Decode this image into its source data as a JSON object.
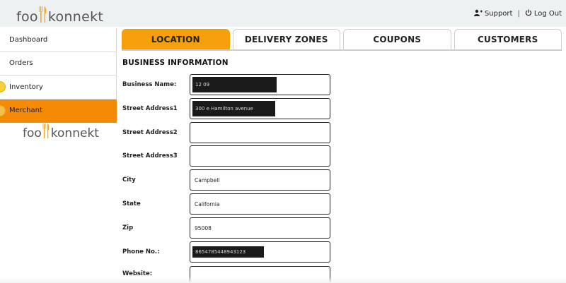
{
  "header": {
    "logo_text_left": "foo",
    "logo_text_right": "konnekt",
    "support_label": "Support",
    "logout_label": "Log Out",
    "separator": "|"
  },
  "sidebar": {
    "items": [
      {
        "label": "Dashboard"
      },
      {
        "label": "Orders"
      },
      {
        "label": "Inventory"
      },
      {
        "label": "Merchant"
      }
    ],
    "logo_text_left": "foo",
    "logo_text_right": "konnekt"
  },
  "tabs": [
    {
      "label": "LOCATION",
      "active": true
    },
    {
      "label": "DELIVERY ZONES"
    },
    {
      "label": "COUPONS"
    },
    {
      "label": "CUSTOMERS"
    }
  ],
  "form": {
    "section_title": "BUSINESS INFORMATION",
    "fields": [
      {
        "label": "Business Name:",
        "value": "12 09",
        "redacted": true
      },
      {
        "label": "Street Address1",
        "value": "300 e Hamilton avenue",
        "redacted": true
      },
      {
        "label": "Street Address2",
        "value": ""
      },
      {
        "label": "Street Address3",
        "value": ""
      },
      {
        "label": "City",
        "value": "Campbell"
      },
      {
        "label": "State",
        "value": "California"
      },
      {
        "label": "Zip",
        "value": "95008"
      },
      {
        "label": "Phone No.:",
        "value": "8654785448943123",
        "redacted": true
      },
      {
        "label": "Website:",
        "value": ""
      }
    ]
  },
  "colors": {
    "accent_orange": "#f58a07",
    "tab_orange": "#f5a00a",
    "header_bg": "#edf1f1"
  }
}
